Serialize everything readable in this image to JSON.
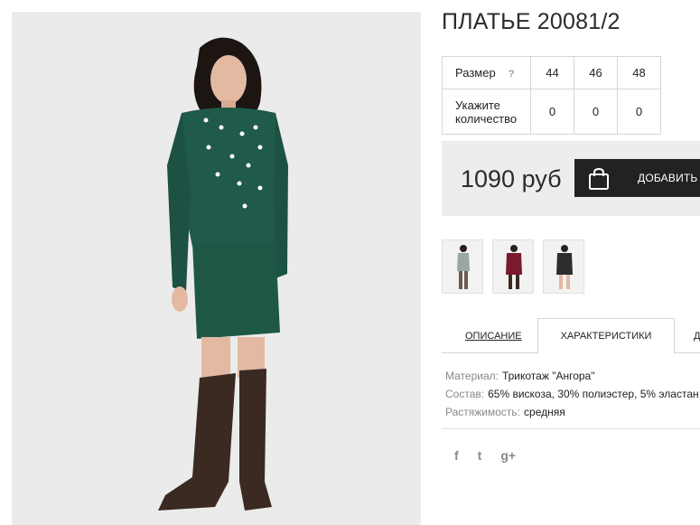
{
  "product": {
    "title": "ПЛАТЬЕ 20081/2"
  },
  "sizes": {
    "size_label": "Размер",
    "help_mark": "?",
    "qty_label": "Укажите количество",
    "values": [
      "44",
      "46",
      "48"
    ],
    "quantities": [
      "0",
      "0",
      "0"
    ]
  },
  "purchase": {
    "price": "1090 руб",
    "add_label": "ДОБАВИТЬ В"
  },
  "tabs": {
    "description": "ОПИСАНИЕ",
    "characteristics": "ХАРАКТЕРИСТИКИ",
    "third": "Д"
  },
  "specs": {
    "material_key": "Материал:",
    "material_val": "Трикотаж \"Ангора\"",
    "composition_key": "Состав:",
    "composition_val": "65% вискоза, 30% полиэстер, 5% эластан",
    "stretch_key": "Растяжимость:",
    "stretch_val": "средняя"
  },
  "social": {
    "facebook": "f",
    "twitter": "t",
    "google": "g+"
  },
  "colors": {
    "dress_green": "#1f5a4a",
    "boots": "#3a2a22",
    "button_bg": "#222222",
    "price_bg": "#ededed"
  }
}
